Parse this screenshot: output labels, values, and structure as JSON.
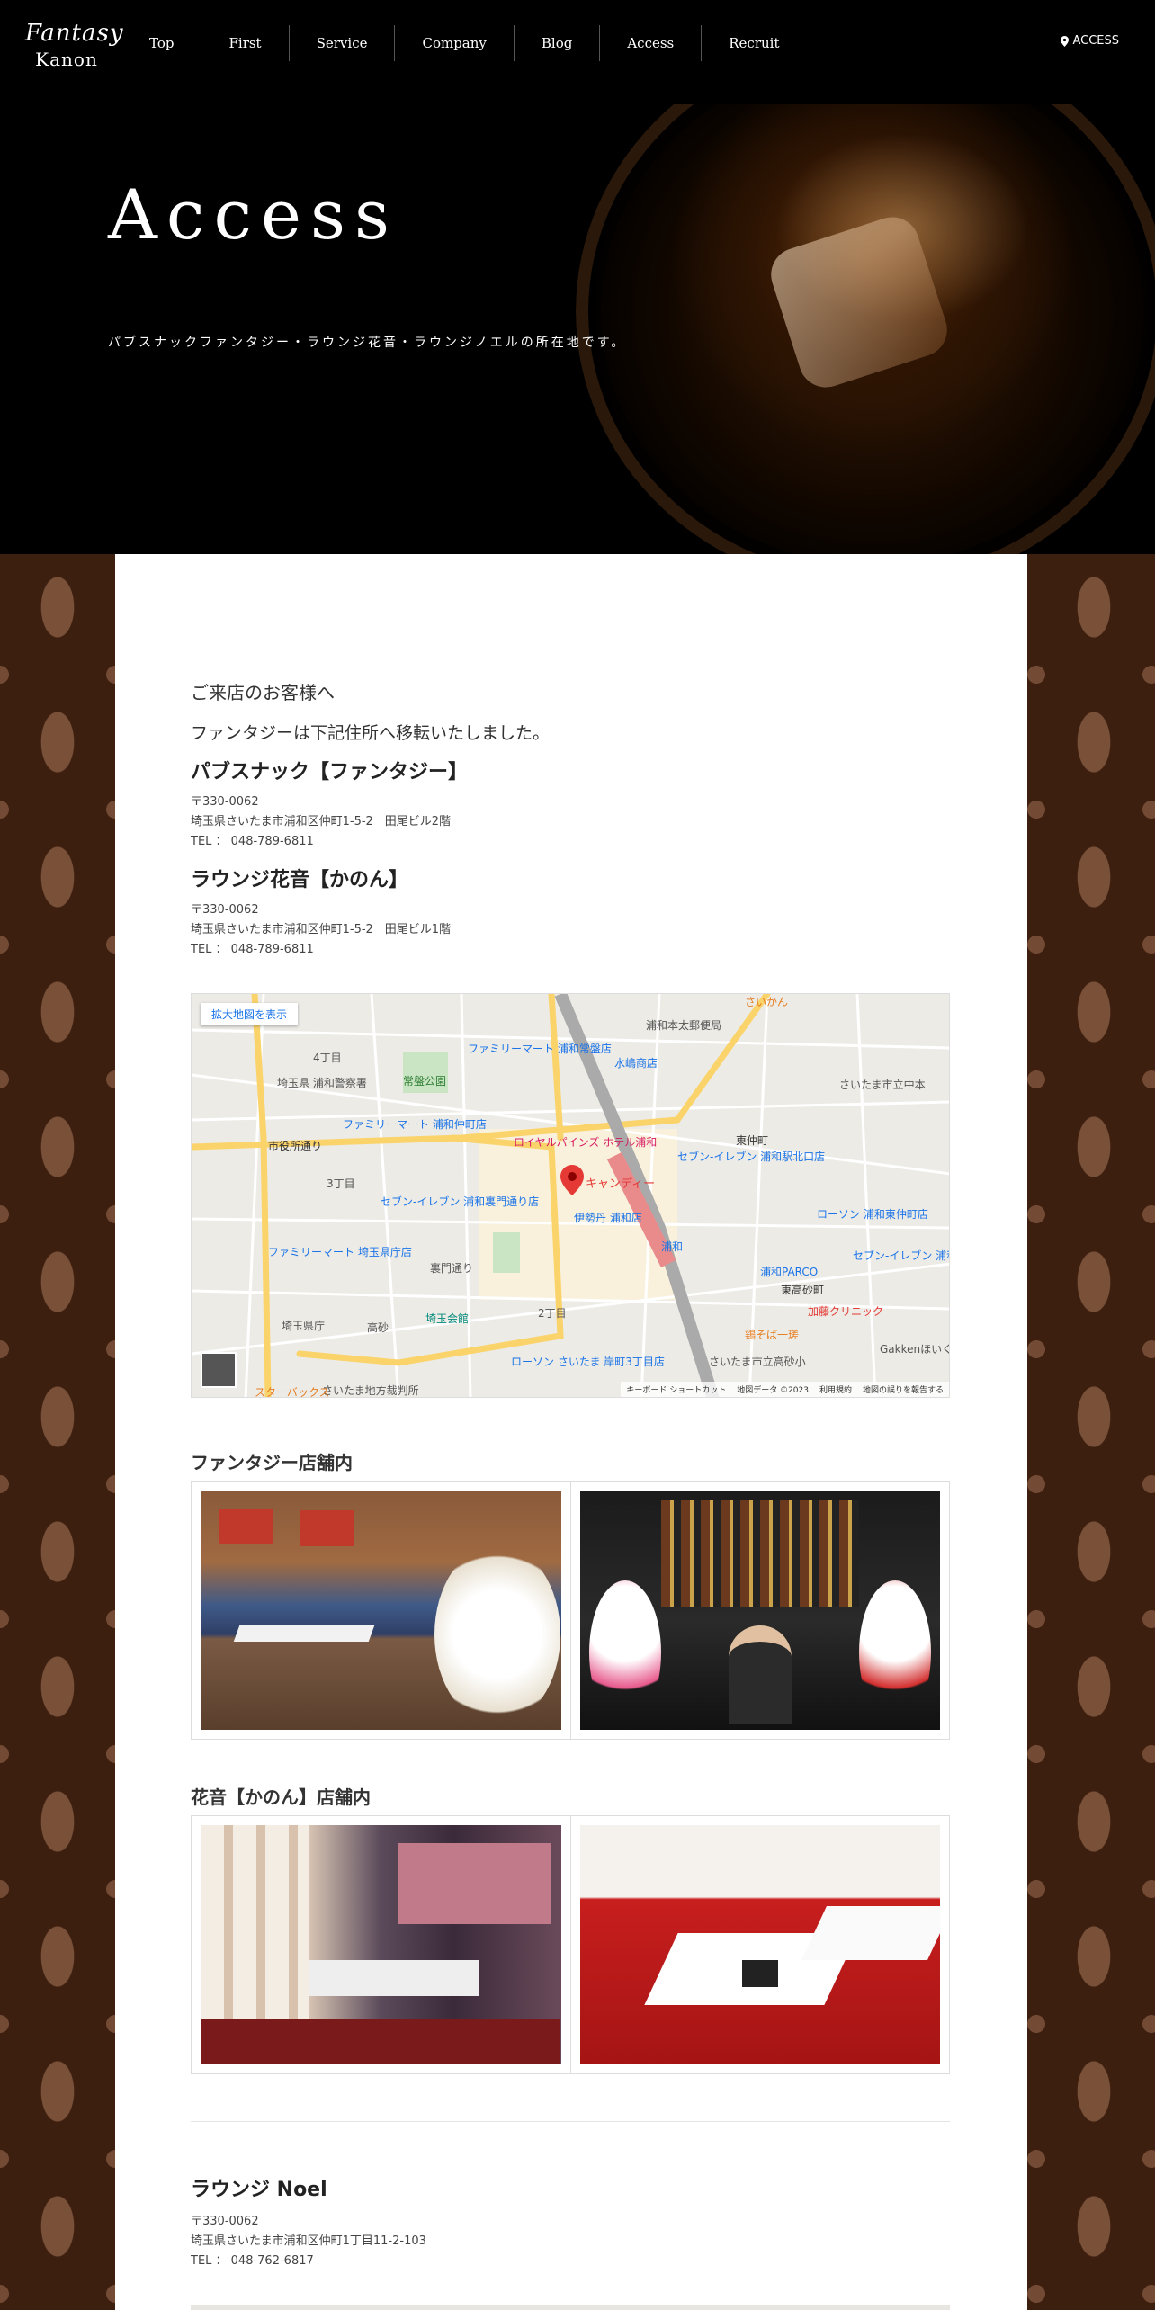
{
  "header": {
    "logo_top": "Fantasy",
    "logo_bottom": "Kanon",
    "nav": [
      "Top",
      "First",
      "Service",
      "Company",
      "Blog",
      "Access",
      "Recruit"
    ],
    "access_label": "ACCESS"
  },
  "hero": {
    "title": "Access",
    "subtitle": "パブスナックファンタジー・ラウンジ花音・ラウンジノエルの所在地です。"
  },
  "notice": {
    "greeting": "ご来店のお客様へ",
    "moved": "ファンタジーは下記住所へ移転いたしました。"
  },
  "shops": [
    {
      "name": "パブスナック【ファンタジー】",
      "postal": "〒330-0062",
      "address": "埼玉県さいたま市浦和区仲町1-5-2　田尾ビル2階",
      "tel": "TEL ： 048-789-6811"
    },
    {
      "name": "ラウンジ花音【かのん】",
      "postal": "〒330-0062",
      "address": "埼玉県さいたま市浦和区仲町1-5-2　田尾ビル1階",
      "tel": "TEL ： 048-789-6811"
    },
    {
      "name": "ラウンジ Noel",
      "postal": "〒330-0062",
      "address": "埼玉県さいたま市浦和区仲町1丁目11-2-103",
      "tel": "TEL ： 048-762-6817"
    }
  ],
  "map": {
    "link_label": "拡大地図を表示",
    "pin_label": "キャンディー",
    "labels": [
      "ファミリーマート 浦和常盤店",
      "水嶋商店",
      "浦和本太郵便局",
      "埼玉県 浦和警察署",
      "常盤公園",
      "ファミリーマート 浦和仲町店",
      "ロイヤルパインズ ホテル浦和",
      "セブン-イレブン 浦和駅北口店",
      "東仲町",
      "市役所通り",
      "3丁目",
      "4丁目",
      "セブン-イレブン 浦和裏門通り店",
      "伊勢丹 浦和店",
      "ローソン 浦和東仲町店",
      "ファミリーマート 埼玉県庁店",
      "浦和PARCO",
      "セブン-イレブン 浦和東高砂町店",
      "東高砂町",
      "加藤クリニック",
      "埼玉県庁",
      "高砂",
      "埼玉会館",
      "2丁目",
      "鶏そば一瑳",
      "ローソン さいたま 岸町3丁目店",
      "さいたま市立高砂小",
      "Gakkenほいくえん 浦和前",
      "さいたま地方裁判所",
      "スターバックス",
      "さいたま市立中本",
      "裏門通り",
      "浦和",
      "さいかん"
    ],
    "footer": [
      "キーボード ショートカット",
      "地図データ ©2023",
      "利用規約",
      "地図の誤りを報告する"
    ]
  },
  "galleries": [
    {
      "title": "ファンタジー店舗内"
    },
    {
      "title": "花音【かのん】店舗内"
    }
  ],
  "colors": {
    "header_bg": "#000000",
    "pattern_bg": "#3d1f10",
    "panel_bg": "#ffffff",
    "map_pin": "#e53935"
  }
}
